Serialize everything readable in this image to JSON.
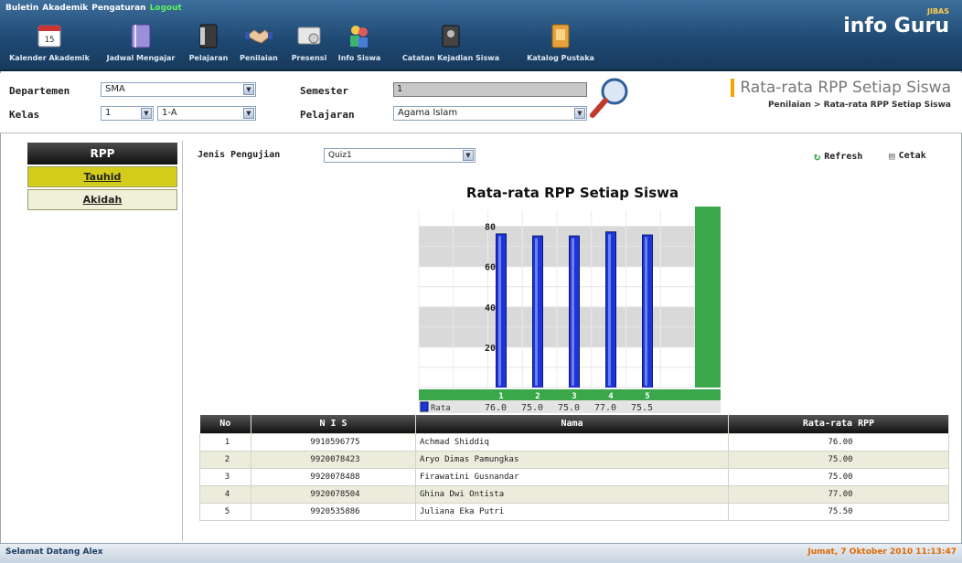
{
  "topmenu": {
    "items": [
      "Buletin",
      "Akademik",
      "Pengaturan"
    ],
    "logout": "Logout"
  },
  "nav": [
    {
      "label": "Kalender Akademik",
      "icon": "calendar-icon",
      "badge": "15"
    },
    {
      "label": "Jadwal Mengajar",
      "icon": "schedule-book-icon"
    },
    {
      "label": "Pelajaran",
      "icon": "binder-icon"
    },
    {
      "label": "Penilaian",
      "icon": "handshake-icon"
    },
    {
      "label": "Presensi",
      "icon": "check-card-icon"
    },
    {
      "label": "Info Siswa",
      "icon": "students-icon"
    },
    {
      "label": "Catatan Kejadian Siswa",
      "icon": "notebook-icon"
    },
    {
      "label": "Katalog Pustaka",
      "icon": "library-folder-icon"
    }
  ],
  "brand": {
    "jibas": "JIBAS",
    "name": "info Guru"
  },
  "filter": {
    "departemen_label": "Departemen",
    "departemen_value": "SMA",
    "kelas_label": "Kelas",
    "tingkat_value": "1",
    "kelas_value": "1-A",
    "semester_label": "Semester",
    "semester_value": "1",
    "pelajaran_label": "Pelajaran",
    "pelajaran_value": "Agama Islam"
  },
  "page": {
    "title": "Rata-rata RPP Setiap Siswa",
    "breadcrumb": "Penilaian  >  Rata-rata RPP Setiap Siswa"
  },
  "sidebar": {
    "heading": "RPP",
    "items": [
      {
        "label": "Tauhid",
        "selected": true
      },
      {
        "label": "Akidah",
        "selected": false
      }
    ]
  },
  "main": {
    "jenis_label": "Jenis Pengujian",
    "jenis_value": "Quiz1",
    "refresh": "Refresh",
    "cetak": "Cetak"
  },
  "chart_data": {
    "type": "bar",
    "title": "Rata-rata RPP Setiap Siswa",
    "categories": [
      "1",
      "2",
      "3",
      "4",
      "5"
    ],
    "series": [
      {
        "name": "Rata",
        "values": [
          76.0,
          75.0,
          75.0,
          77.0,
          75.5
        ],
        "value_labels": [
          "76.0",
          "75.0",
          "75.0",
          "77.0",
          "75.5"
        ]
      }
    ],
    "yticks": [
      "20",
      "40",
      "60",
      "80"
    ],
    "ylim": [
      0,
      88
    ],
    "grid": true
  },
  "table": {
    "headers": [
      "No",
      "N I S",
      "Nama",
      "Rata-rata RPP"
    ],
    "rows": [
      [
        "1",
        "9910596775",
        "Achmad Shiddiq",
        "76.00"
      ],
      [
        "2",
        "9920078423",
        "Aryo Dimas Pamungkas",
        "75.00"
      ],
      [
        "3",
        "9920078488",
        "Firawatini Gusnandar",
        "75.00"
      ],
      [
        "4",
        "9920078504",
        "Ghina Dwi Ontista",
        "77.00"
      ],
      [
        "5",
        "9920535886",
        "Juliana Eka Putri",
        "75.50"
      ]
    ]
  },
  "status": {
    "welcome": "Selamat Datang Alex",
    "datetime": "Jumat, 7 Oktober 2010 11:13:47"
  },
  "colors": {
    "bar": "#1d35d8",
    "accent_green": "#3aa84a",
    "header_blue": "#1f4a74",
    "selected_item": "#d4cc1a",
    "sidebar_item": "#f0f0d8"
  }
}
